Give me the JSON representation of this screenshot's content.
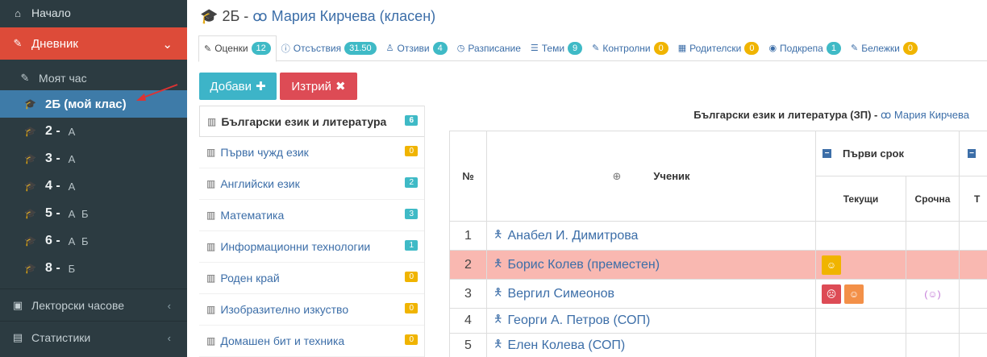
{
  "title": {
    "class": "2Б",
    "separator": "-",
    "teacher": "Мария Кирчева (класен)"
  },
  "sidebar": {
    "top": "Начало",
    "diary": "Дневник",
    "my_hour": "Моят час",
    "my_class": "2Б (мой клас)",
    "classes": [
      {
        "num": "2 -",
        "letters": "А"
      },
      {
        "num": "3 -",
        "letters": "А"
      },
      {
        "num": "4 -",
        "letters": "А"
      },
      {
        "num": "5 -",
        "letters": "А  Б"
      },
      {
        "num": "6 -",
        "letters": "А  Б"
      },
      {
        "num": "8 -",
        "letters": "Б"
      }
    ],
    "lecturer": "Лекторски часове",
    "stats": "Статистики"
  },
  "tabs": [
    {
      "label": "Оценки",
      "badge": "12"
    },
    {
      "label": "Отсъствия",
      "badge": "31.50"
    },
    {
      "label": "Отзиви",
      "badge": "4"
    },
    {
      "label": "Разписание",
      "badge": ""
    },
    {
      "label": "Теми",
      "badge": "9"
    },
    {
      "label": "Контролни",
      "badge": "0"
    },
    {
      "label": "Родителски",
      "badge": "0"
    },
    {
      "label": "Подкрепа",
      "badge": "1"
    },
    {
      "label": "Бележки",
      "badge": "0"
    }
  ],
  "buttons": {
    "add": "Добави",
    "delete": "Изтрий"
  },
  "subjects": [
    {
      "label": "Български език и литература",
      "count": "6"
    },
    {
      "label": "Първи чужд език",
      "count": "0"
    },
    {
      "label": "Английски език",
      "count": "2"
    },
    {
      "label": "Математика",
      "count": "3"
    },
    {
      "label": "Информационни технологии",
      "count": "1"
    },
    {
      "label": "Роден край",
      "count": "0"
    },
    {
      "label": "Изобразително изкуство",
      "count": "0"
    },
    {
      "label": "Домашен бит и техника",
      "count": "0"
    }
  ],
  "subject_heading": {
    "subject": "Български език и литература (ЗП)",
    "dash": "-",
    "teacher": "Мария Кирчева"
  },
  "table": {
    "col_no": "№",
    "col_student": "Ученик",
    "term": "Първи срок",
    "current": "Текущи",
    "term_grade": "Срочна",
    "next_current": "Т",
    "rows": [
      {
        "no": "1",
        "name": "Анабел И. Димитрова"
      },
      {
        "no": "2",
        "name": "Борис Колев (преместен)"
      },
      {
        "no": "3",
        "name": "Вергил Симеонов"
      },
      {
        "no": "4",
        "name": "Георги А. Петров (СОП)"
      },
      {
        "no": "5",
        "name": "Елен Колева (СОП)"
      }
    ]
  },
  "colors": {
    "accent": "#3c6ea8",
    "danger": "#dd4b39",
    "sidebar": "#2c3b41"
  }
}
